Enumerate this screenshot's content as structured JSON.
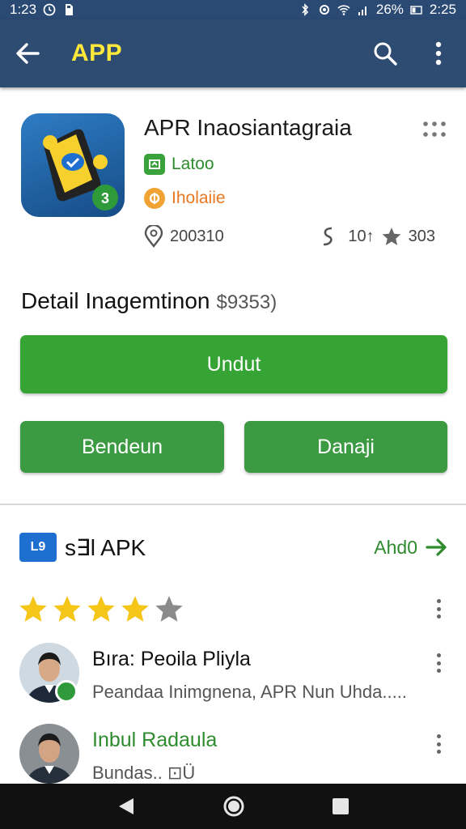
{
  "status_bar": {
    "time_left": "1:23",
    "battery": "26%",
    "time_right": "2:25"
  },
  "app_bar": {
    "title": "APP"
  },
  "app": {
    "name": "APR Inaosiantagraia",
    "developer": "Latoo",
    "category": "Iholaiie",
    "downloads": "200310",
    "reviews_count": "10↑",
    "rating": "303"
  },
  "details": {
    "title": "Detail Inagemtinon",
    "size": "$9353)"
  },
  "buttons": {
    "download": "Undut",
    "share": "Bendeun",
    "delete": "Danaji"
  },
  "reviews": {
    "badge": "L9",
    "title": "s∃l APK",
    "see_all": "Ahd0",
    "stars": {
      "filled": 4,
      "total": 5
    },
    "items": [
      {
        "name": "Bıra: Peoila Pliyla",
        "text": "Peandaa Inimgnena, APR Nun Uhda....."
      },
      {
        "name": "Inbul Radaula",
        "text": "Bundas.. ⊡Ü"
      }
    ]
  },
  "colors": {
    "app_bar": "#2e4b72",
    "title_accent": "#ffe93a",
    "primary_green": "#35a435",
    "link_green": "#2e8b2e",
    "category_orange": "#e87722"
  },
  "icons": [
    "back-arrow-icon",
    "search-icon",
    "more-vert-icon",
    "grid-dots-icon",
    "location-pin-icon",
    "star-icon",
    "arrow-right-icon",
    "nav-back-icon",
    "nav-home-icon",
    "nav-recents-icon"
  ]
}
